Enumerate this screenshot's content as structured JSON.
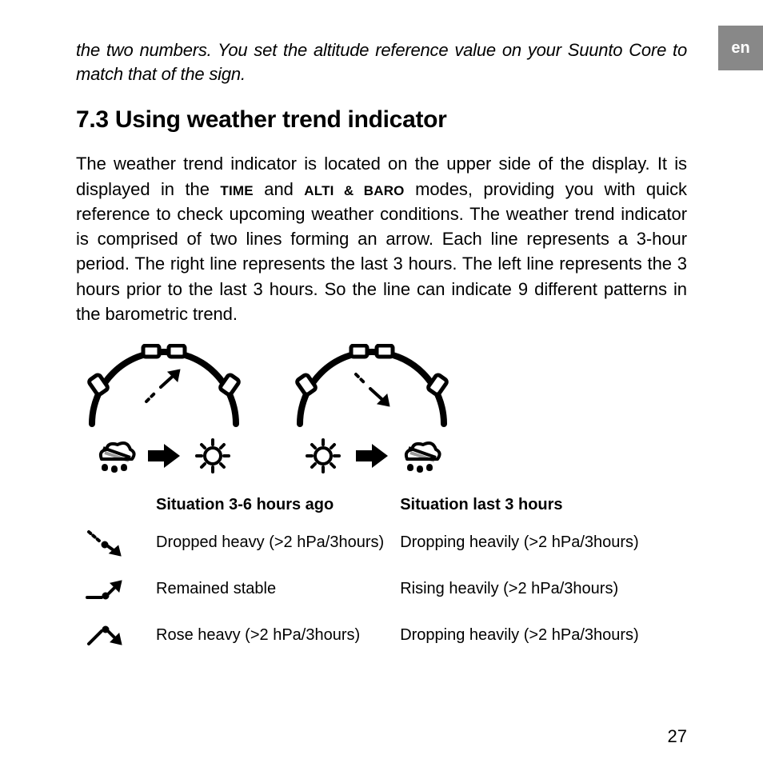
{
  "lang_tab": "en",
  "page_number": "27",
  "lead_paragraph": "the two numbers. You set the altitude reference value on your Suunto Core to match that of the sign.",
  "section_heading": "7.3 Using weather trend indicator",
  "body_pre": "The weather trend indicator is located on the upper side of the display. It is displayed in the ",
  "mode1": "TIME",
  "body_mid1": " and ",
  "mode2": "ALTI & BARO",
  "body_post": " modes, providing you with quick reference to check upcoming weather conditions. The weather trend indicator is comprised of two lines forming an arrow. Each line represents a 3-hour period. The right line represents the last 3 hours. The left line represents the 3 hours prior to the last 3 hours. So the line can indicate 9 different patterns in the barometric trend.",
  "table": {
    "header_prev": "Situation 3-6 hours ago",
    "header_now": "Situation last 3 hours",
    "rows": [
      {
        "prev": "Dropped heavy (>2 hPa/3hours)",
        "now": "Dropping heavily (>2 hPa/3hours)"
      },
      {
        "prev": "Remained stable",
        "now": "Rising heavily (>2 hPa/3hours)"
      },
      {
        "prev": "Rose heavy (>2 hPa/3hours)",
        "now": "Dropping heavily (>2 hPa/3hours)"
      }
    ]
  }
}
